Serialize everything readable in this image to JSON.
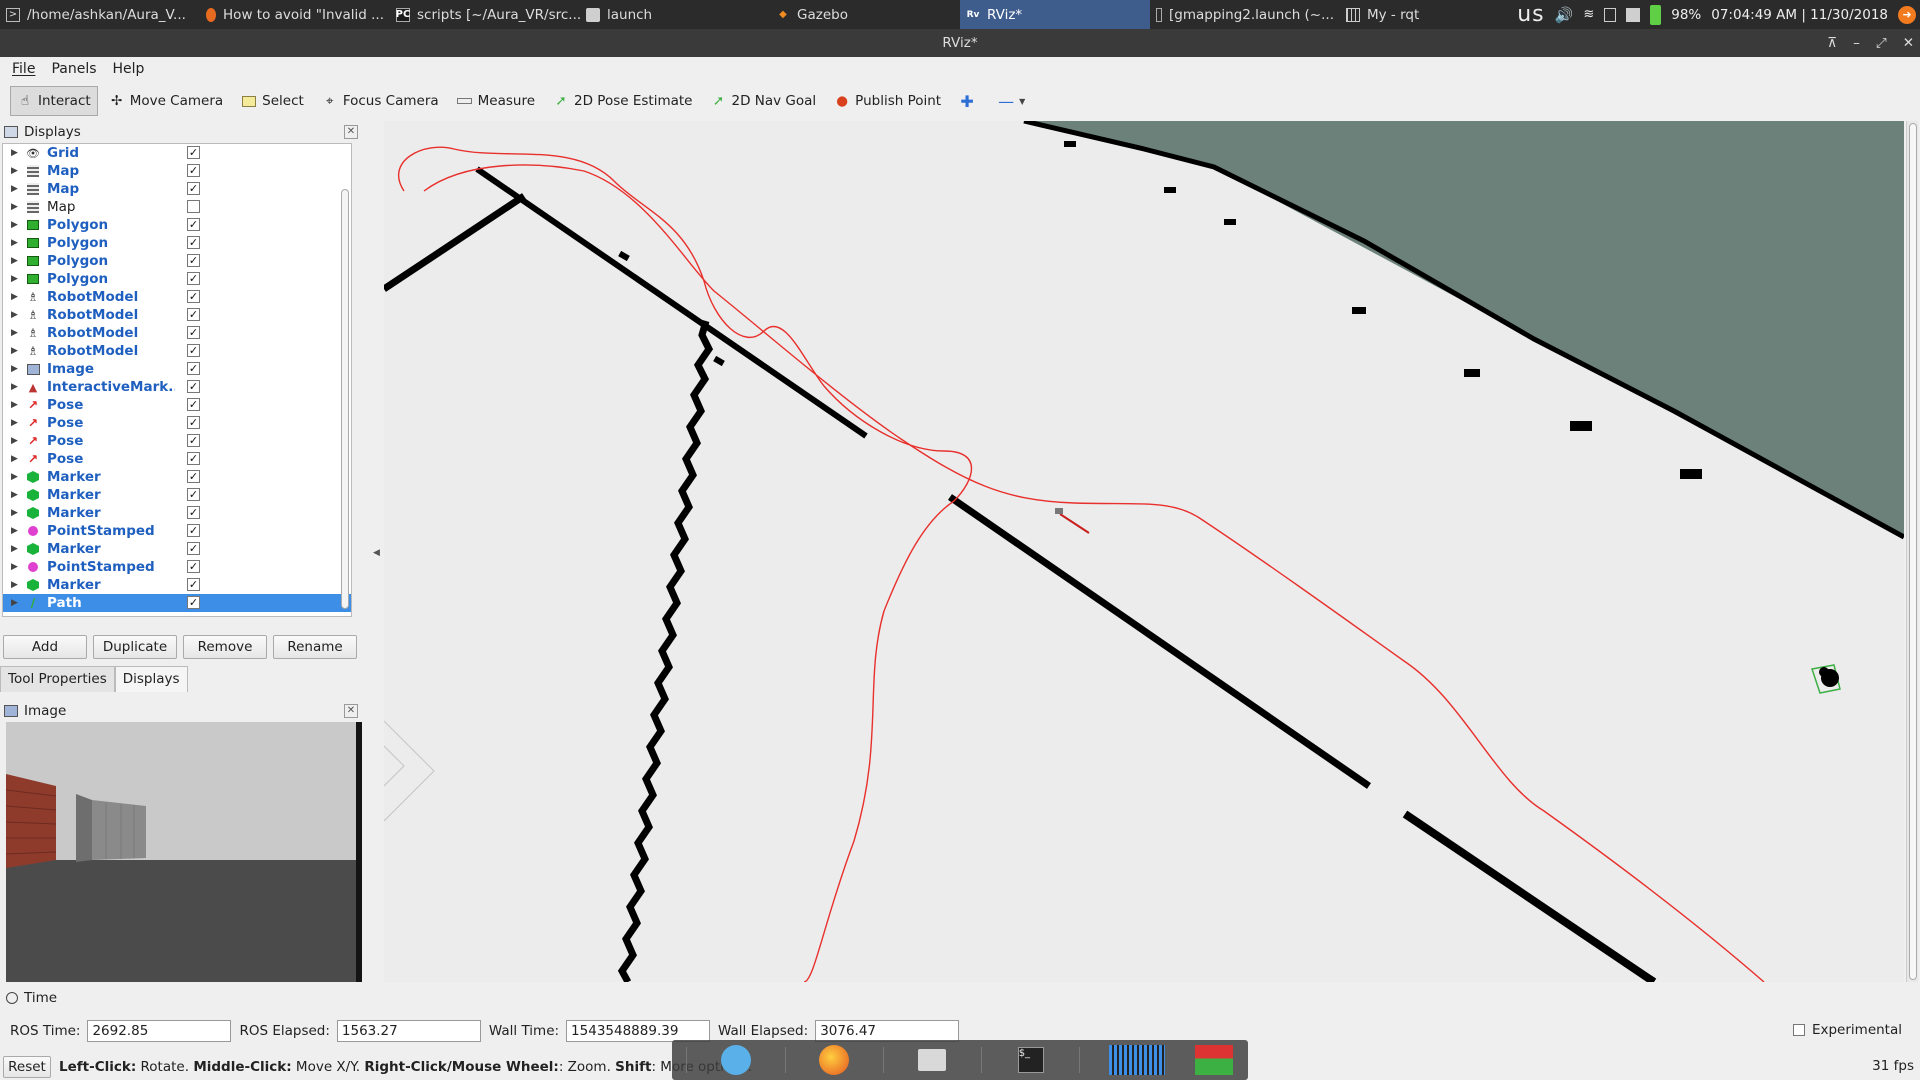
{
  "taskbar": {
    "tasks": [
      {
        "label": "/home/ashkan/Aura_V..."
      },
      {
        "label": "How to avoid \"Invalid ..."
      },
      {
        "label": "scripts [~/Aura_VR/src..."
      },
      {
        "label": "launch"
      },
      {
        "label": "Gazebo"
      },
      {
        "label": "RViz*"
      },
      {
        "label": "[gmapping2.launch (~..."
      },
      {
        "label": "My - rqt"
      }
    ],
    "keyboard": "us",
    "battery": "98%",
    "clock": "07:04:49 AM | 11/30/2018"
  },
  "window": {
    "title": "RViz*"
  },
  "menu": {
    "file": "File",
    "panels": "Panels",
    "help": "Help"
  },
  "toolbar": {
    "interact": "Interact",
    "move_camera": "Move Camera",
    "select": "Select",
    "focus_camera": "Focus Camera",
    "measure": "Measure",
    "pose_estimate": "2D Pose Estimate",
    "nav_goal": "2D Nav Goal",
    "publish_point": "Publish Point"
  },
  "displays": {
    "title": "Displays",
    "items": [
      {
        "label": "Grid",
        "type": "grid",
        "checked": true,
        "enabled": true
      },
      {
        "label": "Map",
        "type": "map",
        "checked": true,
        "enabled": true
      },
      {
        "label": "Map",
        "type": "map",
        "checked": true,
        "enabled": true
      },
      {
        "label": "Map",
        "type": "map",
        "checked": false,
        "enabled": false
      },
      {
        "label": "Polygon",
        "type": "polygon",
        "checked": true,
        "enabled": true
      },
      {
        "label": "Polygon",
        "type": "polygon",
        "checked": true,
        "enabled": true
      },
      {
        "label": "Polygon",
        "type": "polygon",
        "checked": true,
        "enabled": true
      },
      {
        "label": "Polygon",
        "type": "polygon",
        "checked": true,
        "enabled": true
      },
      {
        "label": "RobotModel",
        "type": "robot",
        "checked": true,
        "enabled": true
      },
      {
        "label": "RobotModel",
        "type": "robot",
        "checked": true,
        "enabled": true
      },
      {
        "label": "RobotModel",
        "type": "robot",
        "checked": true,
        "enabled": true
      },
      {
        "label": "RobotModel",
        "type": "robot",
        "checked": true,
        "enabled": true
      },
      {
        "label": "Image",
        "type": "image",
        "checked": true,
        "enabled": true
      },
      {
        "label": "InteractiveMark...",
        "type": "interactive",
        "checked": true,
        "enabled": true
      },
      {
        "label": "Pose",
        "type": "pose",
        "checked": true,
        "enabled": true
      },
      {
        "label": "Pose",
        "type": "pose",
        "checked": true,
        "enabled": true
      },
      {
        "label": "Pose",
        "type": "pose",
        "checked": true,
        "enabled": true
      },
      {
        "label": "Pose",
        "type": "pose",
        "checked": true,
        "enabled": true
      },
      {
        "label": "Marker",
        "type": "marker",
        "checked": true,
        "enabled": true
      },
      {
        "label": "Marker",
        "type": "marker",
        "checked": true,
        "enabled": true
      },
      {
        "label": "Marker",
        "type": "marker",
        "checked": true,
        "enabled": true
      },
      {
        "label": "PointStamped",
        "type": "point",
        "checked": true,
        "enabled": true
      },
      {
        "label": "Marker",
        "type": "marker",
        "checked": true,
        "enabled": true
      },
      {
        "label": "PointStamped",
        "type": "point",
        "checked": true,
        "enabled": true
      },
      {
        "label": "Marker",
        "type": "marker",
        "checked": true,
        "enabled": true
      },
      {
        "label": "Path",
        "type": "path",
        "checked": true,
        "enabled": true,
        "selected": true
      }
    ],
    "buttons": {
      "add": "Add",
      "duplicate": "Duplicate",
      "remove": "Remove",
      "rename": "Rename"
    },
    "tabs": {
      "tool_properties": "Tool Properties",
      "displays": "Displays"
    }
  },
  "image_panel": {
    "title": "Image"
  },
  "time": {
    "title": "Time",
    "ros_time_label": "ROS Time:",
    "ros_time": "2692.85",
    "ros_elapsed_label": "ROS Elapsed:",
    "ros_elapsed": "1563.27",
    "wall_time_label": "Wall Time:",
    "wall_time": "1543548889.39",
    "wall_elapsed_label": "Wall Elapsed:",
    "wall_elapsed": "3076.47",
    "experimental": "Experimental"
  },
  "status": {
    "reset": "Reset",
    "help_parts": [
      {
        "b": "Left-Click:",
        "t": " Rotate. "
      },
      {
        "b": "Middle-Click:",
        "t": " Move X/Y. "
      },
      {
        "b": "Right-Click/Mouse Wheel:",
        "t": ": Zoom. "
      },
      {
        "b": "Shift",
        "t": ": More options."
      }
    ],
    "fps": "31 fps"
  },
  "colors": {
    "accent": "#3d8ee6",
    "link_blue": "#1f5fbf",
    "path_red": "#e8302c",
    "obstacle_gray": "#6b817a"
  }
}
